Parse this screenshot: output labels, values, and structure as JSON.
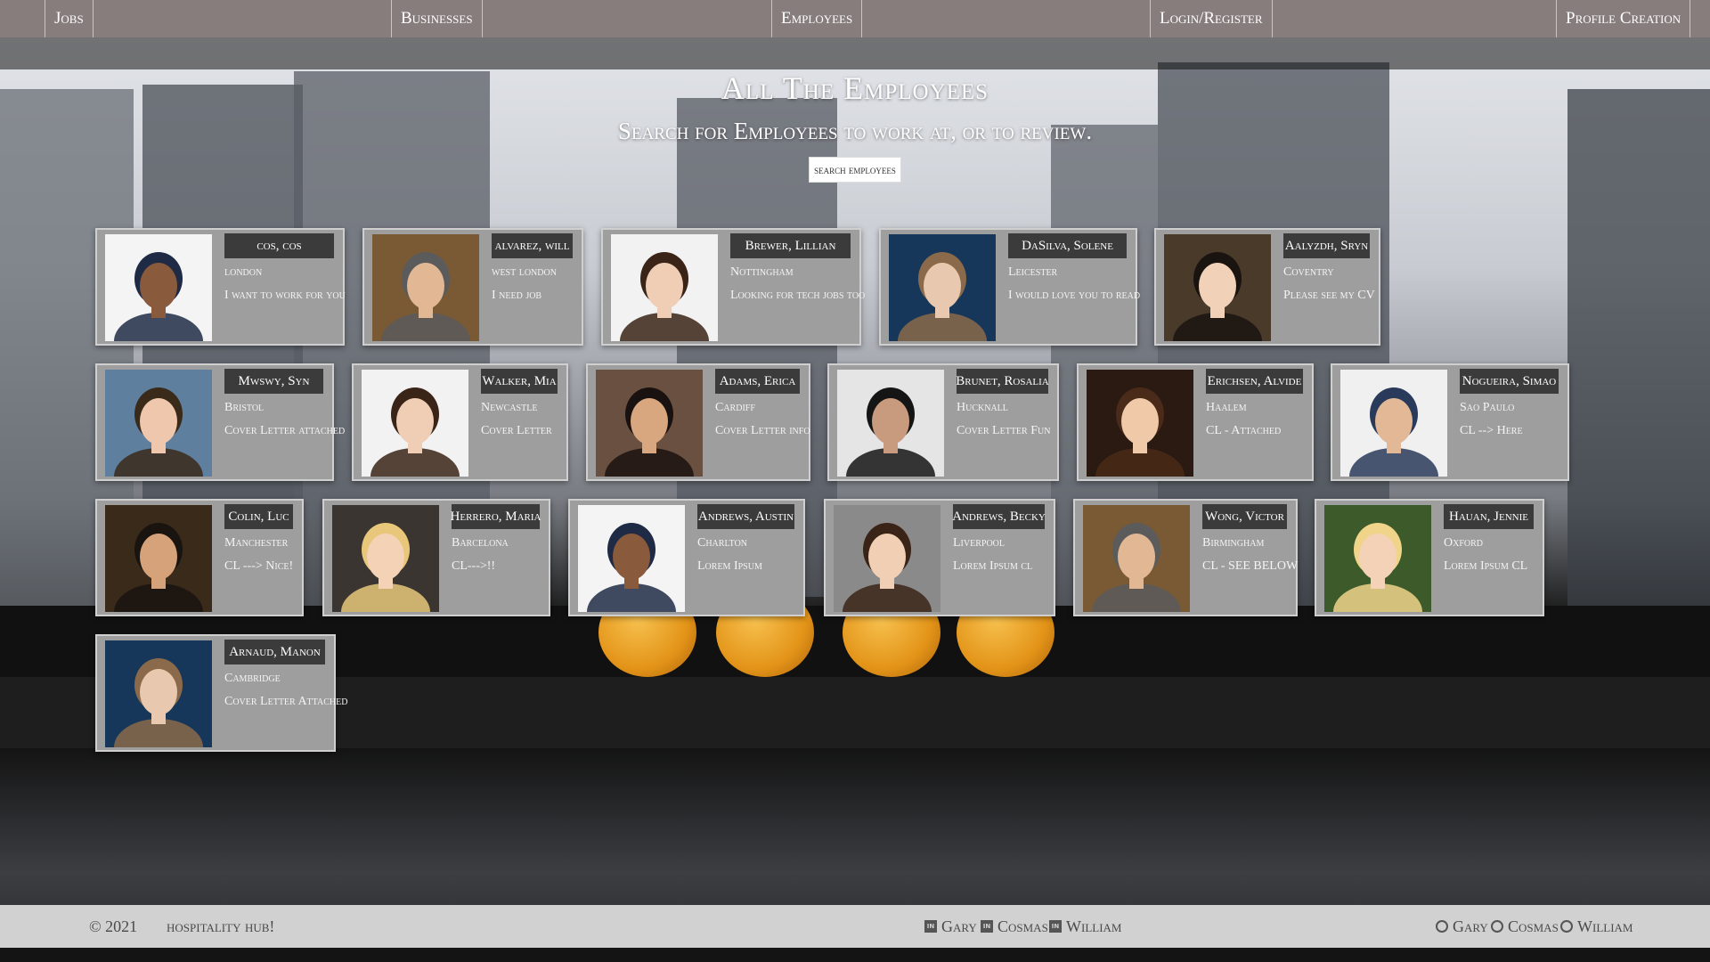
{
  "nav": {
    "items": [
      {
        "label": "Jobs"
      },
      {
        "label": "Businesses"
      },
      {
        "label": "Employees"
      },
      {
        "label": "Login/Register"
      },
      {
        "label": "Profile Creation"
      }
    ]
  },
  "header": {
    "title": "All The Employees",
    "subtitle": "Search for Employees to work at, or to review.",
    "search_button": "search employees"
  },
  "employees": [
    {
      "name": "cos, cos",
      "location": "london",
      "note": "I want to work for you"
    },
    {
      "name": "alvarez, will",
      "location": "west london",
      "note": "I need job"
    },
    {
      "name": "Brewer, Lillian",
      "location": "Nottingham",
      "note": "Looking for tech jobs too"
    },
    {
      "name": "DaSilva, Solene",
      "location": "Leicester",
      "note": "I would love you to read"
    },
    {
      "name": "Aalyzdh, Sryn",
      "location": "Coventry",
      "note": "Please see my CV"
    },
    {
      "name": "Mwswy, Syn",
      "location": "Bristol",
      "note": "Cover Letter attached"
    },
    {
      "name": "Walker, Mia",
      "location": "Newcastle",
      "note": "Cover Letter"
    },
    {
      "name": "Adams, Erica",
      "location": "Cardiff",
      "note": "Cover Letter info"
    },
    {
      "name": "Brunet, Rosalia",
      "location": "Hucknall",
      "note": "Cover Letter Fun"
    },
    {
      "name": "Erichsen, Alvide",
      "location": "Haalem",
      "note": "CL - Attached"
    },
    {
      "name": "Nogueira, Simao",
      "location": "Sao Paulo",
      "note": "CL --> Here"
    },
    {
      "name": "Colin, Luc",
      "location": "Manchester",
      "note": "CL ---> Nice!"
    },
    {
      "name": "Herrero, Maria",
      "location": "Barcelona",
      "note": "CL--->!!"
    },
    {
      "name": "Andrews, Austin",
      "location": "Charlton",
      "note": "Lorem Ipsum"
    },
    {
      "name": "Andrews, Becky",
      "location": "Liverpool",
      "note": "Lorem Ipsum cl"
    },
    {
      "name": "Wong, Victor",
      "location": "Birmingham",
      "note": "CL - SEE BELOW"
    },
    {
      "name": "Hauan, Jennie",
      "location": "Oxford",
      "note": "Lorem Ipsum CL"
    },
    {
      "name": "Arnaud, Manon",
      "location": "Cambridge",
      "note": "Cover Letter Attached"
    }
  ],
  "footer": {
    "copyright": "© 2021",
    "brand": "hospitality hub!",
    "linkedin_links": [
      "Gary",
      "Cosmas",
      "William"
    ],
    "github_links": [
      "Gary",
      "Cosmas",
      "William"
    ]
  }
}
